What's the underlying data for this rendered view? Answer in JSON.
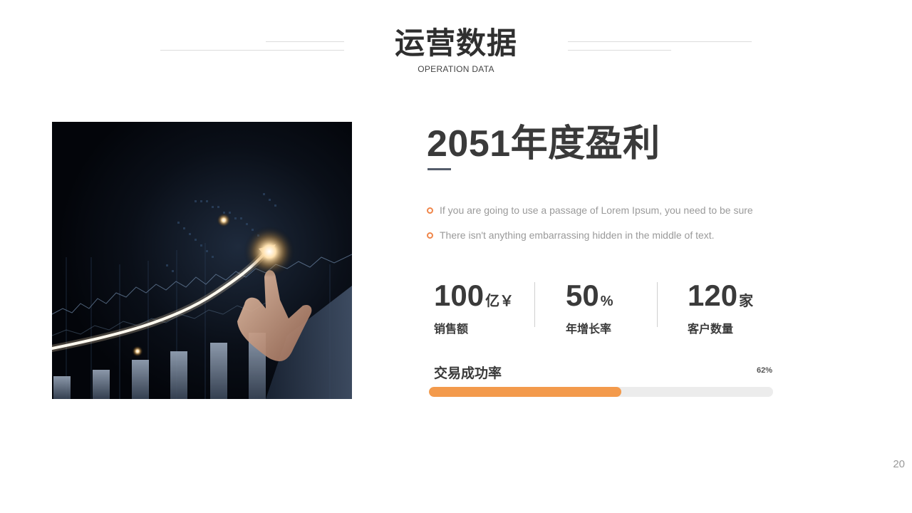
{
  "header": {
    "title": "运营数据",
    "subtitle": "OPERATION DATA"
  },
  "content": {
    "headline": "2051年度盈利",
    "bullets": [
      "If you are going to use a passage of Lorem Ipsum, you need to be sure",
      "There isn't anything embarrassing hidden in the middle of text."
    ],
    "stats": [
      {
        "value": "100",
        "unit": "亿￥",
        "label": "销售额"
      },
      {
        "value": "50",
        "unit": "%",
        "label": "年增长率"
      },
      {
        "value": "120",
        "unit": "家",
        "label": "客户数量"
      }
    ],
    "progress": {
      "label": "交易成功率",
      "value_text": "62%",
      "fraction": 0.56
    }
  },
  "footer": {
    "page_number": "20"
  },
  "colors": {
    "accent": "#f39a4c",
    "track": "#ececec",
    "text_dark": "#3a3a3a",
    "text_muted": "#9a9a9a",
    "rule": "#545d6b"
  }
}
